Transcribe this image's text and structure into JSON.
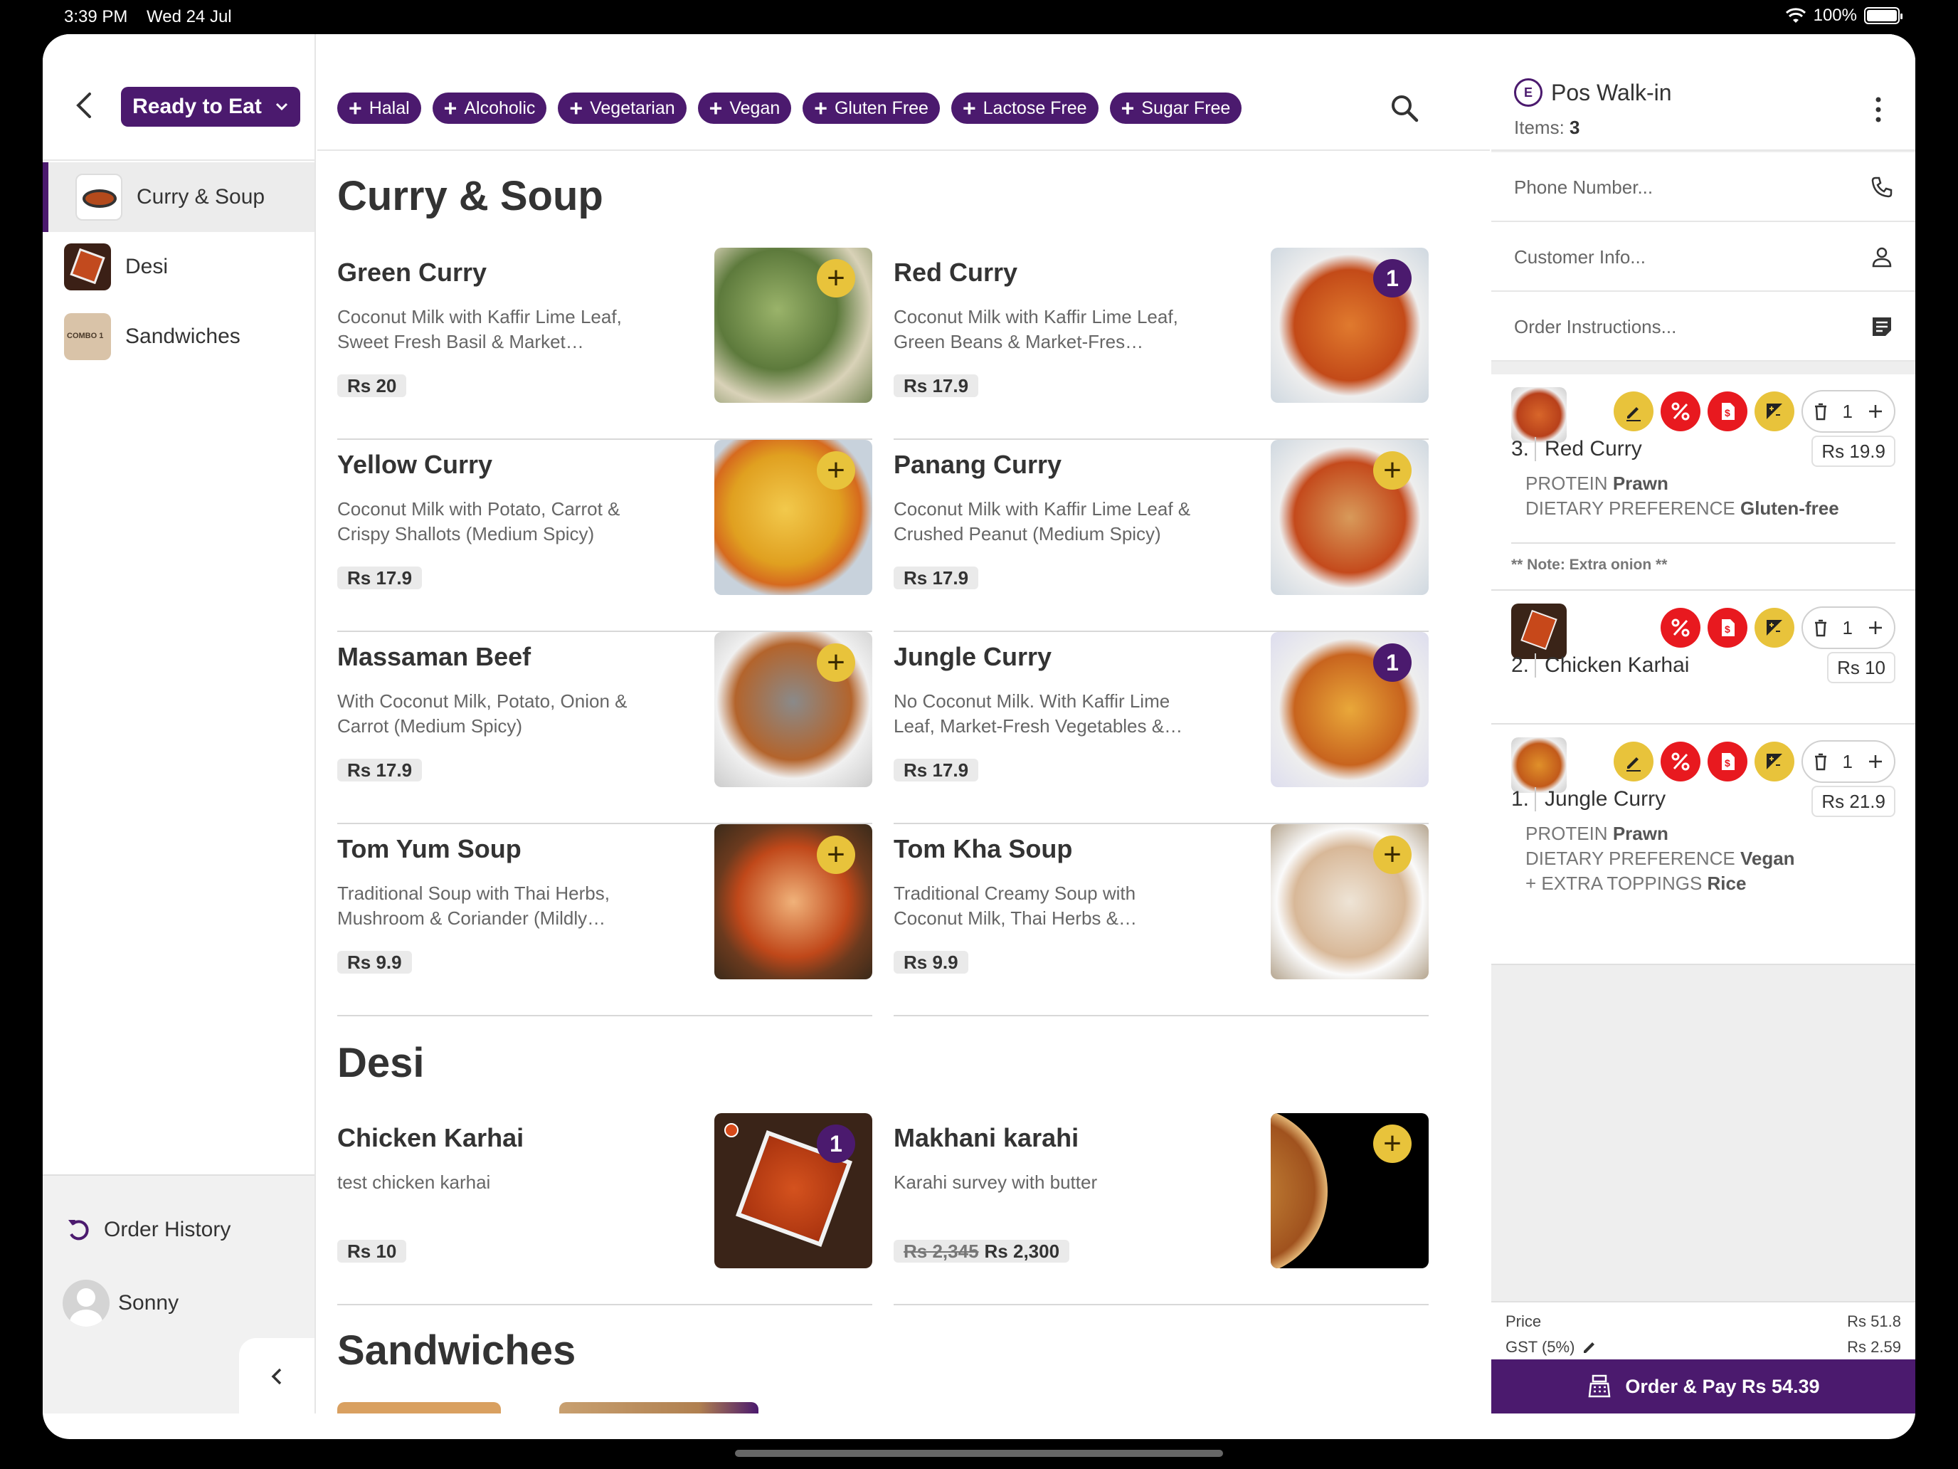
{
  "status_bar": {
    "time": "3:39 PM",
    "date": "Wed 24 Jul",
    "battery": "100%"
  },
  "sidebar": {
    "mode_label": "Ready to Eat",
    "categories": [
      {
        "label": "Curry & Soup",
        "active": true
      },
      {
        "label": "Desi",
        "active": false
      },
      {
        "label": "Sandwiches",
        "active": false,
        "thumb_text": "COMBO 1"
      }
    ],
    "order_history_label": "Order History",
    "user_name": "Sonny"
  },
  "filters": [
    "Halal",
    "Alcoholic",
    "Vegetarian",
    "Vegan",
    "Gluten Free",
    "Lactose Free",
    "Sugar Free"
  ],
  "menu": {
    "sections": [
      {
        "title": "Curry & Soup",
        "items": [
          {
            "name": "Green Curry",
            "desc": "Coconut Milk with Kaffir Lime Leaf, Sweet Fresh Basil & Market…",
            "price": "Rs 20",
            "badge": "+"
          },
          {
            "name": "Red Curry",
            "desc": "Coconut Milk with Kaffir Lime Leaf, Green Beans & Market-Fres…",
            "price": "Rs 17.9",
            "badge": "1"
          },
          {
            "name": "Yellow Curry",
            "desc": "Coconut Milk with Potato, Carrot & Crispy Shallots (Medium Spicy)",
            "price": "Rs 17.9",
            "badge": "+"
          },
          {
            "name": "Panang Curry",
            "desc": "Coconut Milk with Kaffir Lime Leaf & Crushed Peanut (Medium Spicy)",
            "price": "Rs 17.9",
            "badge": "+"
          },
          {
            "name": "Massaman Beef",
            "desc": "With Coconut Milk, Potato, Onion & Carrot (Medium Spicy)",
            "price": "Rs 17.9",
            "badge": "+"
          },
          {
            "name": "Jungle Curry",
            "desc": "No Coconut Milk. With Kaffir Lime Leaf, Market-Fresh Vegetables &…",
            "price": "Rs 17.9",
            "badge": "1"
          },
          {
            "name": "Tom Yum Soup",
            "desc": "Traditional Soup with Thai Herbs, Mushroom & Coriander (Mildly…",
            "price": "Rs 9.9",
            "badge": "+"
          },
          {
            "name": "Tom Kha Soup",
            "desc": "Traditional Creamy Soup with Coconut Milk, Thai Herbs &…",
            "price": "Rs 9.9",
            "badge": "+"
          }
        ]
      },
      {
        "title": "Desi",
        "items": [
          {
            "name": "Chicken Karhai",
            "desc": "test chicken karhai",
            "price": "Rs 10",
            "badge": "1"
          },
          {
            "name": "Makhani karahi",
            "desc": "Karahi survey with butter",
            "old_price": "Rs 2,345",
            "price": "Rs 2,300",
            "badge": "+"
          }
        ]
      },
      {
        "title": "Sandwiches"
      }
    ]
  },
  "cart": {
    "title": "Pos Walk-in",
    "items_label": "Items:",
    "items_count": "3",
    "fields": {
      "phone": "Phone Number...",
      "customer": "Customer Info...",
      "instructions": "Order Instructions..."
    },
    "lines": [
      {
        "index": "3.",
        "name": "Red Curry",
        "price": "Rs 19.9",
        "qty": "1",
        "mods": [
          {
            "key": "PROTEIN",
            "value": "Prawn"
          },
          {
            "key": "DIETARY PREFERENCE",
            "value": "Gluten-free"
          }
        ],
        "note": "** Note: Extra onion **"
      },
      {
        "index": "2.",
        "name": "Chicken Karhai",
        "price": "Rs 10",
        "qty": "1"
      },
      {
        "index": "1.",
        "name": "Jungle Curry",
        "price": "Rs 21.9",
        "qty": "1",
        "mods": [
          {
            "key": "PROTEIN",
            "value": "Prawn"
          },
          {
            "key": "DIETARY PREFERENCE",
            "value": "Vegan"
          },
          {
            "key": "+ EXTRA TOPPINGS",
            "value": "Rice"
          }
        ]
      }
    ],
    "totals": {
      "price_label": "Price",
      "price_value": "Rs 51.8",
      "gst_label": "GST (5%)",
      "gst_value": "Rs 2.59"
    },
    "pay_label": "Order & Pay Rs 54.39"
  },
  "colors": {
    "brand": "#4b1a6e",
    "add": "#e8c33b",
    "danger": "#e8191f"
  }
}
